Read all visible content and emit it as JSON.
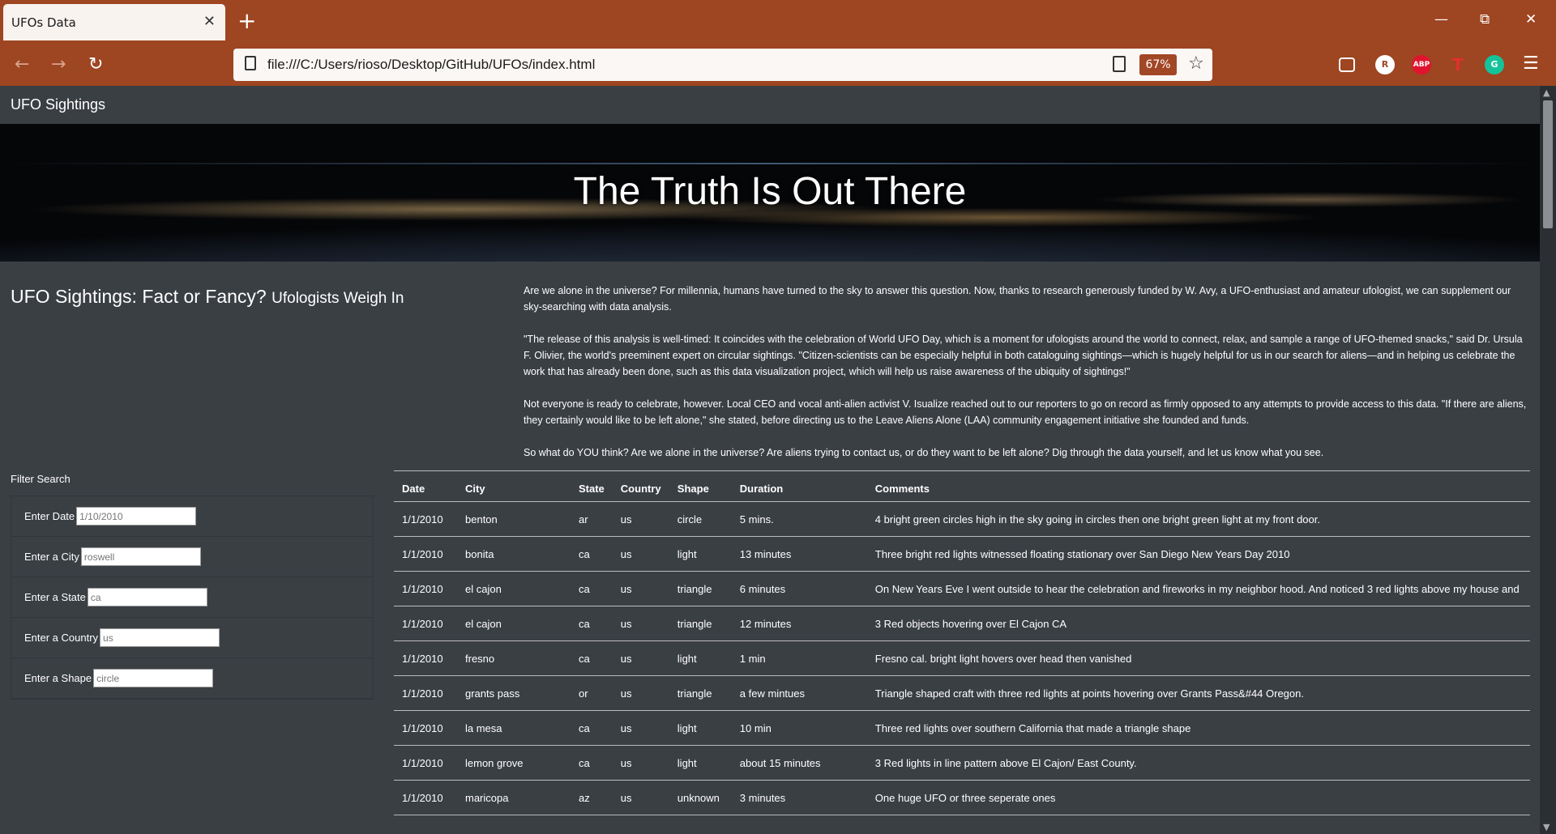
{
  "browser": {
    "tab_title": "UFOs Data",
    "tab_close": "✕",
    "new_tab": "+",
    "url": "file:///C:/Users/rioso/Desktop/GitHub/UFOs/index.html",
    "zoom": "67%",
    "ext_r": "R",
    "ext_abp": "ABP",
    "ext_t": "T",
    "ext_g": "G"
  },
  "navbar": {
    "brand": "UFO Sightings"
  },
  "hero": {
    "title": "The Truth Is Out There"
  },
  "heading": {
    "main": "UFO Sightings: Fact or Fancy?",
    "small": "Ufologists Weigh In"
  },
  "article": {
    "p1": "Are we alone in the universe? For millennia, humans have turned to the sky to answer this question. Now, thanks to research generously funded by W. Avy, a UFO-enthusiast and amateur ufologist, we can supplement our sky-searching with data analysis.",
    "p2": "\"The release of this analysis is well-timed: It coincides with the celebration of World UFO Day, which is a moment for ufologists around the world to connect, relax, and sample a range of UFO-themed snacks,\" said Dr. Ursula F. Olivier, the world's preeminent expert on circular sightings. \"Citizen-scientists can be especially helpful in both cataloguing sightings—which is hugely helpful for us in our search for aliens—and in helping us celebrate the work that has already been done, such as this data visualization project, which will help us raise awareness of the ubiquity of sightings!\"",
    "p3": "Not everyone is ready to celebrate, however. Local CEO and vocal anti-alien activist V. Isualize reached out to our reporters to go on record as firmly opposed to any attempts to provide access to this data. \"If there are aliens, they certainly would like to be left alone,\" she stated, before directing us to the Leave Aliens Alone (LAA) community engagement initiative she founded and funds.",
    "p4": "So what do YOU think? Are we alone in the universe? Are aliens trying to contact us, or do they want to be left alone? Dig through the data yourself, and let us know what you see."
  },
  "filters": {
    "title": "Filter Search",
    "date_label": "Enter Date",
    "date_placeholder": "1/10/2010",
    "city_label": "Enter a City",
    "city_placeholder": "roswell",
    "state_label": "Enter a State",
    "state_placeholder": "ca",
    "country_label": "Enter a Country",
    "country_placeholder": "us",
    "shape_label": "Enter a Shape",
    "shape_placeholder": "circle"
  },
  "table": {
    "headers": [
      "Date",
      "City",
      "State",
      "Country",
      "Shape",
      "Duration",
      "Comments"
    ],
    "rows": [
      [
        "1/1/2010",
        "benton",
        "ar",
        "us",
        "circle",
        "5 mins.",
        "4 bright green circles high in the sky going in circles then one bright green light at my front door."
      ],
      [
        "1/1/2010",
        "bonita",
        "ca",
        "us",
        "light",
        "13 minutes",
        "Three bright red lights witnessed floating stationary over San Diego New Years Day 2010"
      ],
      [
        "1/1/2010",
        "el cajon",
        "ca",
        "us",
        "triangle",
        "6 minutes",
        "On New Years Eve I went outside to hear the celebration and fireworks in my neighbor hood. And noticed 3 red lights above my house and"
      ],
      [
        "1/1/2010",
        "el cajon",
        "ca",
        "us",
        "triangle",
        "12 minutes",
        "3 Red objects hovering over El Cajon CA"
      ],
      [
        "1/1/2010",
        "fresno",
        "ca",
        "us",
        "light",
        "1 min",
        "Fresno cal. bright light hovers over head then vanished"
      ],
      [
        "1/1/2010",
        "grants pass",
        "or",
        "us",
        "triangle",
        "a few mintues",
        "Triangle shaped craft with three red lights at points hovering over Grants Pass&#44 Oregon."
      ],
      [
        "1/1/2010",
        "la mesa",
        "ca",
        "us",
        "light",
        "10 min",
        "Three red lights over southern California that made a triangle shape"
      ],
      [
        "1/1/2010",
        "lemon grove",
        "ca",
        "us",
        "light",
        "about 15 minutes",
        "3 Red lights in line pattern above El Cajon/ East County."
      ],
      [
        "1/1/2010",
        "maricopa",
        "az",
        "us",
        "unknown",
        "3 minutes",
        "One huge UFO or three seperate ones"
      ]
    ]
  }
}
